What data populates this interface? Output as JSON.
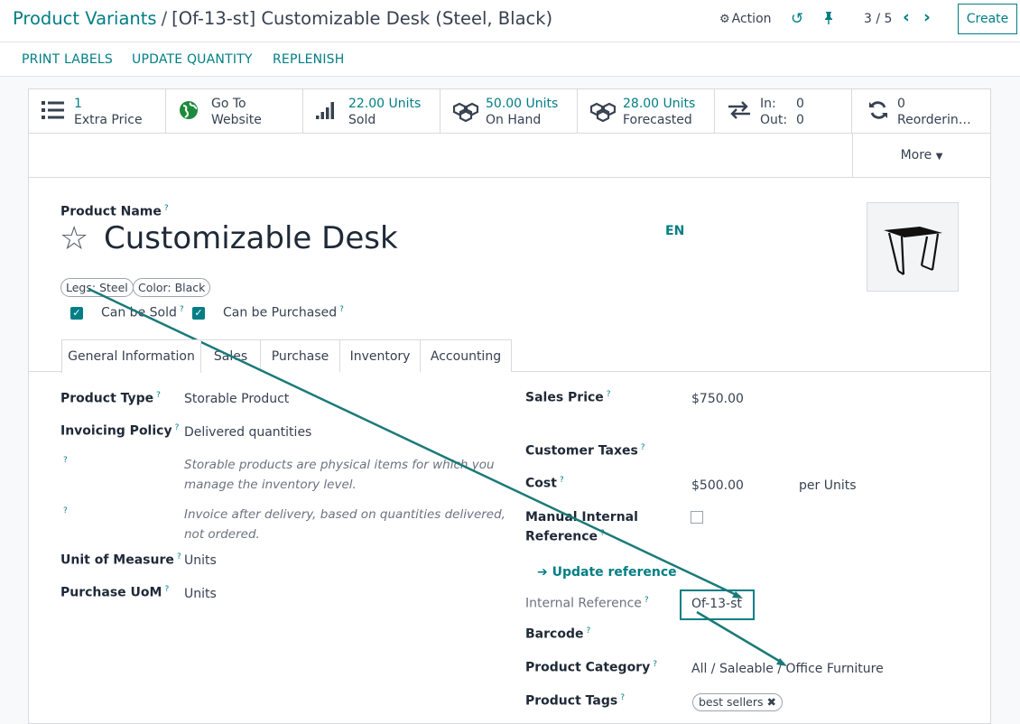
{
  "breadcrumb": {
    "parent": "Product Variants",
    "separator": "/",
    "current": "[Of-13-st] Customizable Desk (Steel, Black)"
  },
  "header": {
    "action_label": "Action",
    "pager": "3 / 5",
    "create_label": "Create"
  },
  "statusbar": {
    "buttons": [
      "PRINT LABELS",
      "UPDATE QUANTITY",
      "REPLENISH"
    ]
  },
  "smart_buttons": [
    {
      "icon": "list-icon",
      "line1": "1",
      "line2": "Extra Price"
    },
    {
      "icon": "globe-icon",
      "line1": "Go To",
      "line2": "Website"
    },
    {
      "icon": "signal-bars-icon",
      "line1": "22.00 Units",
      "line2": "Sold"
    },
    {
      "icon": "cubes-icon",
      "line1": "50.00 Units",
      "line2": "On Hand"
    },
    {
      "icon": "cubes-icon",
      "line1": "28.00 Units",
      "line2": "Forecasted"
    },
    {
      "icon": "exchange-icon",
      "line1": "In:",
      "line1_val": "0",
      "line2": "Out:",
      "line2_val": "0"
    },
    {
      "icon": "refresh-icon",
      "line1": "0",
      "line2": "Reorderin…"
    }
  ],
  "more_label": "More",
  "product": {
    "name_label": "Product Name",
    "name": "Customizable Desk",
    "lang": "EN",
    "attributes": [
      "Legs: Steel",
      "Color: Black"
    ],
    "can_be_sold": "Can be Sold",
    "can_be_purchased": "Can be Purchased"
  },
  "tabs": [
    "General Information",
    "Sales",
    "Purchase",
    "Inventory",
    "Accounting"
  ],
  "left_fields": {
    "product_type_label": "Product Type",
    "product_type": "Storable Product",
    "invoicing_label": "Invoicing Policy",
    "invoicing": "Delivered quantities",
    "help1_line1": "Storable products are physical items for which you",
    "help1_line2": "manage the inventory level.",
    "help2_line1": "Invoice after delivery, based on quantities delivered,",
    "help2_line2": "not ordered.",
    "uom_label": "Unit of Measure",
    "uom": "Units",
    "purchase_uom_label": "Purchase UoM",
    "purchase_uom": "Units"
  },
  "right_fields": {
    "sales_price_label": "Sales Price",
    "sales_price": "$750.00",
    "customer_taxes_label": "Customer Taxes",
    "cost_label": "Cost",
    "cost": "$500.00",
    "cost_unit": "per Units",
    "manual_ref_line1": "Manual Internal",
    "manual_ref_line2": "Reference",
    "update_ref": "Update reference",
    "internal_ref_label": "Internal Reference",
    "internal_ref": "Of-13-st",
    "barcode_label": "Barcode",
    "category_label": "Product Category",
    "category": "All / Saleable / Office Furniture",
    "tags_label": "Product Tags",
    "tag": "best sellers"
  },
  "colors": {
    "accent": "#017e84",
    "annotation": "#1a7a78"
  }
}
